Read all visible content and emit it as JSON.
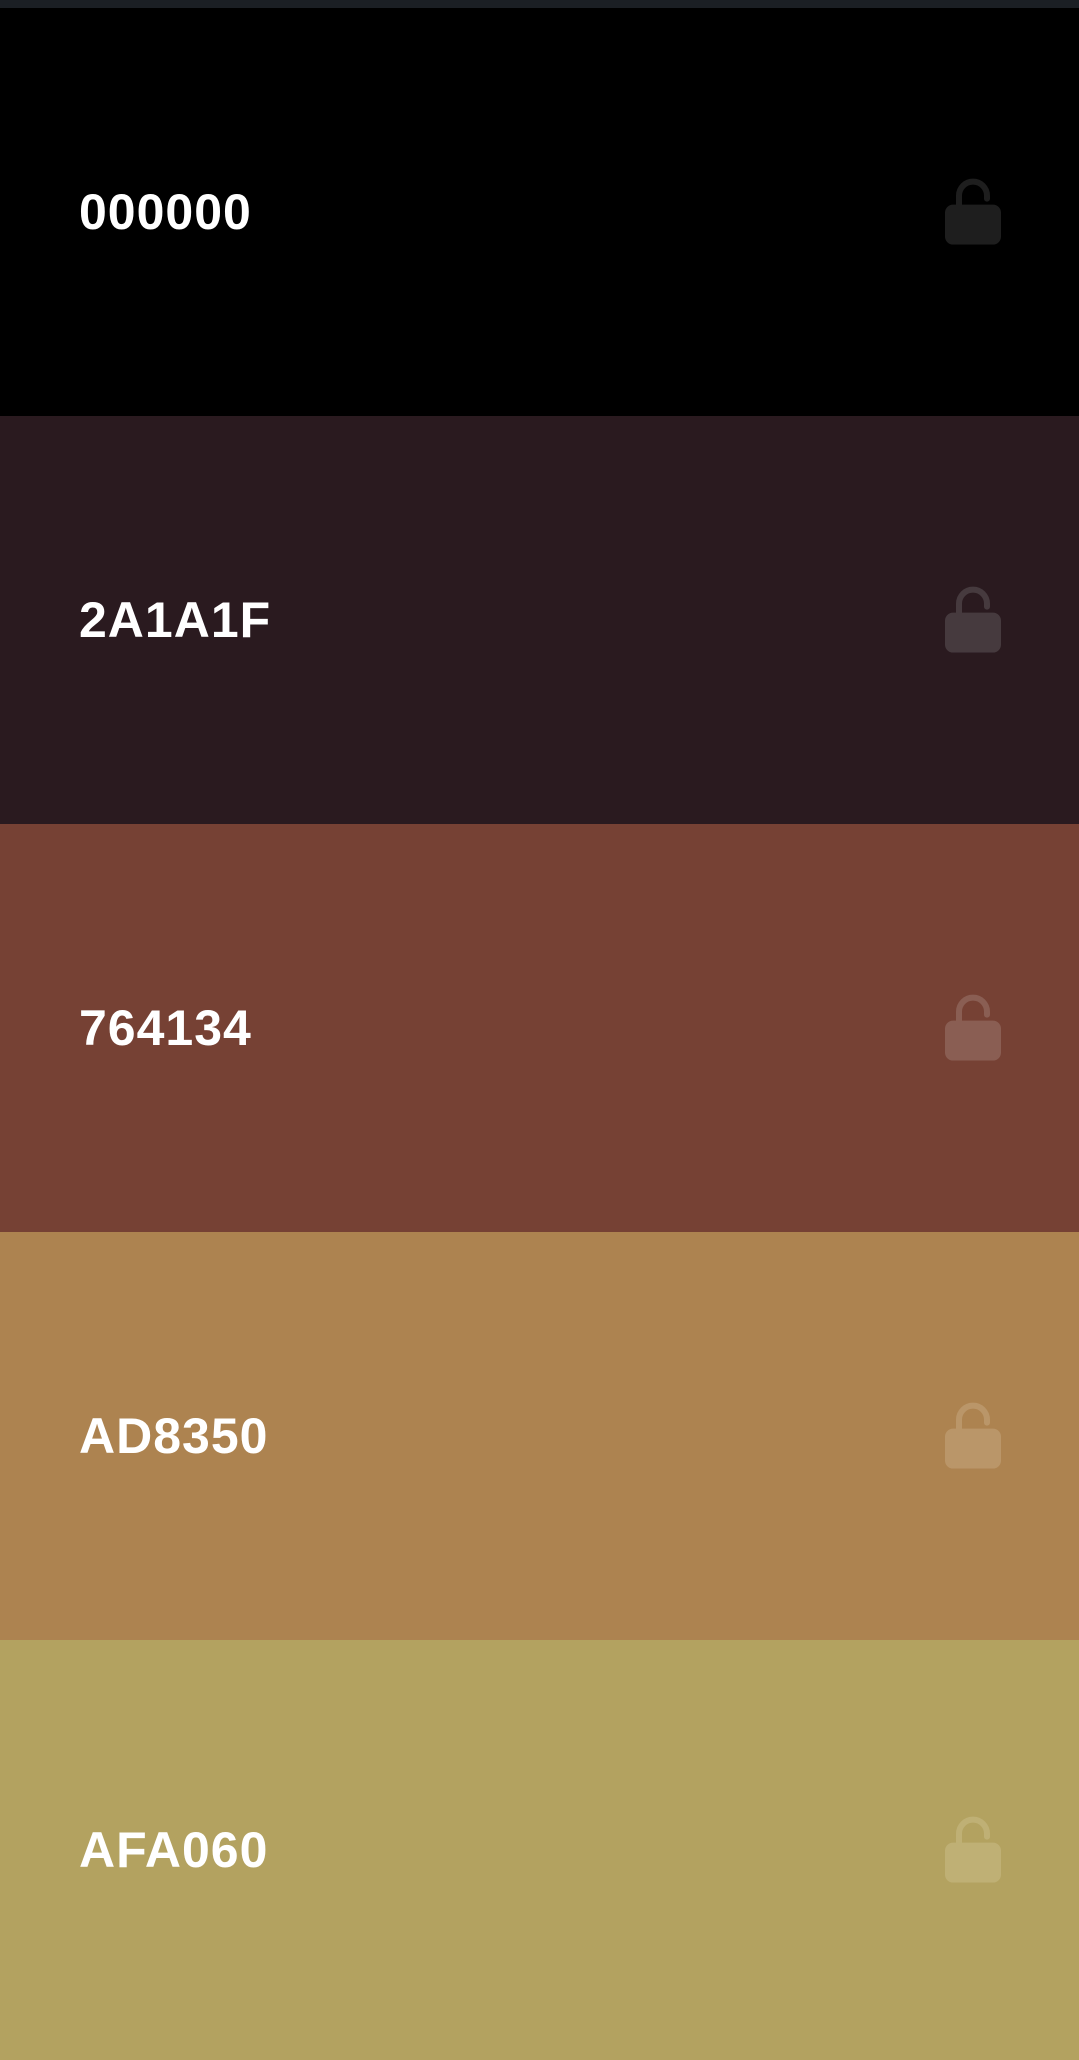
{
  "palette": {
    "colors": [
      {
        "hex": "000000",
        "background": "#000000",
        "lock_icon": "unlocked-lock-icon",
        "lock_color": "#1e1e1e",
        "locked": false
      },
      {
        "hex": "2A1A1F",
        "background": "#2a1a1f",
        "lock_icon": "unlocked-lock-icon",
        "lock_color": "#463a3e",
        "locked": false
      },
      {
        "hex": "764134",
        "background": "#764134",
        "lock_icon": "unlocked-lock-icon",
        "lock_color": "#8a5e53",
        "locked": false
      },
      {
        "hex": "AD8350",
        "background": "#ad8350",
        "lock_icon": "unlocked-lock-icon",
        "lock_color": "#ba9669",
        "locked": false
      },
      {
        "hex": "AFA060",
        "background": "#b3a260",
        "lock_icon": "unlocked-lock-icon",
        "lock_color": "#bfb075",
        "locked": false
      }
    ]
  }
}
